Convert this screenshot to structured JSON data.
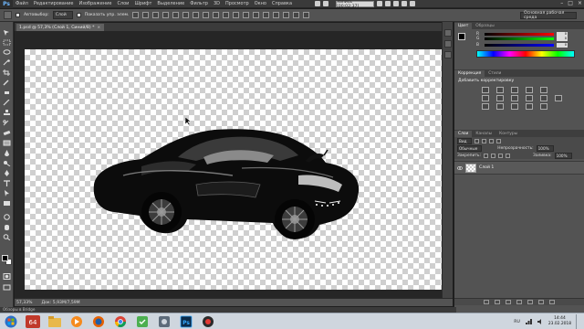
{
  "app": {
    "logo": "Ps"
  },
  "menu": [
    "Файл",
    "Редактирование",
    "Изображение",
    "Слои",
    "Шрифт",
    "Выделение",
    "Фильтр",
    "3D",
    "Просмотр",
    "Окно",
    "Справка"
  ],
  "recorder": {
    "label": "Запись [00:02:37]"
  },
  "options_bar": {
    "auto_select_label": "Автовыбор:",
    "auto_select_value": "Слой",
    "show_controls_label": "Показать упр. элем.",
    "workspace": "Основная рабочая среда"
  },
  "document_tab": {
    "title": "1.psd @ 57,3% (Слой 1, Синий/8) *",
    "close": "×"
  },
  "status": {
    "zoom": "57,33%",
    "doc_size": "Док: 5,93М/7,59М"
  },
  "mini_bridge": "Обзоры в Bridge",
  "color_panel": {
    "tabs": [
      "Цвет",
      "Образцы"
    ],
    "channels": [
      {
        "label": "R",
        "value": "0",
        "color": "#e23a3a"
      },
      {
        "label": "G",
        "value": "0",
        "color": "#3ac43a"
      },
      {
        "label": "B",
        "value": "0",
        "color": "#3a6ae2"
      }
    ]
  },
  "adjustments_panel": {
    "tabs": [
      "Коррекция",
      "Стили"
    ],
    "title": "Добавить корректировку"
  },
  "layers_panel": {
    "tabs": [
      "Слои",
      "Каналы",
      "Контуры"
    ],
    "kind_label": "Вид",
    "blend_mode": "Обычные",
    "opacity_label": "Непрозрачность:",
    "opacity_value": "100%",
    "lock_label": "Закрепить:",
    "fill_label": "Заливка:",
    "fill_value": "100%",
    "layers": [
      {
        "name": "Слой 1"
      }
    ]
  },
  "taskbar": {
    "clock_time": "14:44",
    "clock_date": "23.02.2018",
    "lang": "RU",
    "badge_64": "64",
    "ps_label": "Ps"
  }
}
